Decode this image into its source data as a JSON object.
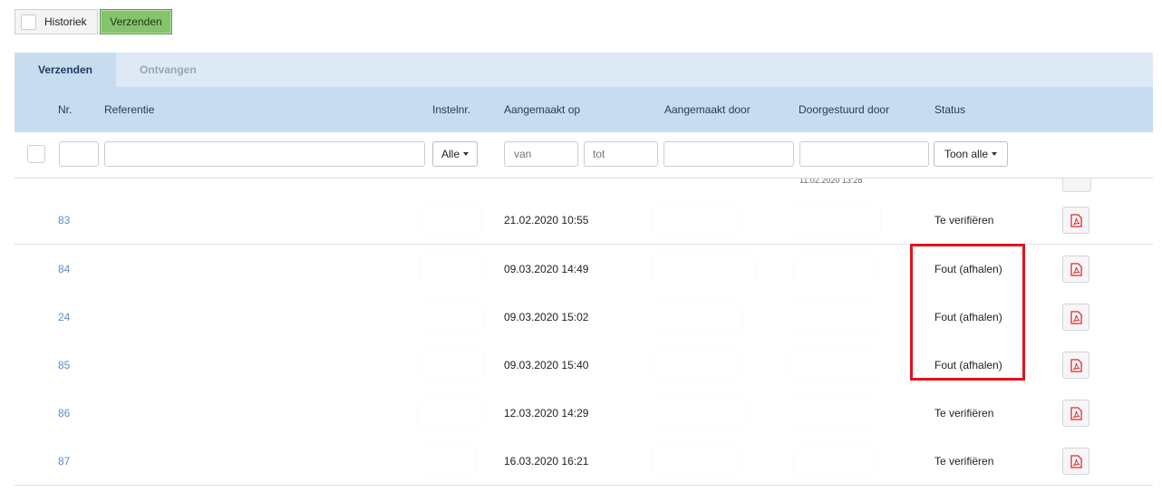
{
  "toolbar": {
    "historiek_label": "Historiek",
    "verzenden_label": "Verzenden"
  },
  "tabs": [
    {
      "label": "Verzenden",
      "active": true
    },
    {
      "label": "Ontvangen",
      "active": false
    }
  ],
  "columns": {
    "nr": "Nr.",
    "referentie": "Referentie",
    "instelnr": "Instelnr.",
    "aangemaakt_op": "Aangemaakt op",
    "aangemaakt_door": "Aangemaakt door",
    "doorgestuurd_door": "Doorgestuurd door",
    "status": "Status"
  },
  "filters": {
    "instelnr_select": "Alle",
    "date_from_placeholder": "van",
    "date_to_placeholder": "tot",
    "status_select": "Toon alle"
  },
  "partial_row": {
    "doorgestuurd_timestamp": "11.02.2020 13:28"
  },
  "rows": [
    {
      "nr": "83",
      "aangemaakt_op": "21.02.2020 10:55",
      "status": "Te verifiëren"
    },
    {
      "nr": "84",
      "aangemaakt_op": "09.03.2020 14:49",
      "status": "Fout (afhalen)"
    },
    {
      "nr": "24",
      "aangemaakt_op": "09.03.2020 15:02",
      "status": "Fout (afhalen)"
    },
    {
      "nr": "85",
      "aangemaakt_op": "09.03.2020 15:40",
      "status": "Fout (afhalen)"
    },
    {
      "nr": "86",
      "aangemaakt_op": "12.03.2020 14:29",
      "status": "Te verifiëren"
    },
    {
      "nr": "87",
      "aangemaakt_op": "16.03.2020 16:21",
      "status": "Te verifiëren"
    }
  ],
  "icons": {
    "row_action": "pdf-icon"
  },
  "colors": {
    "accent_green": "#86c36d",
    "header_blue": "#c7dcf0",
    "link_blue": "#5b8fc7",
    "highlight_red": "#e0141e",
    "pdf_red": "#e0262b"
  }
}
